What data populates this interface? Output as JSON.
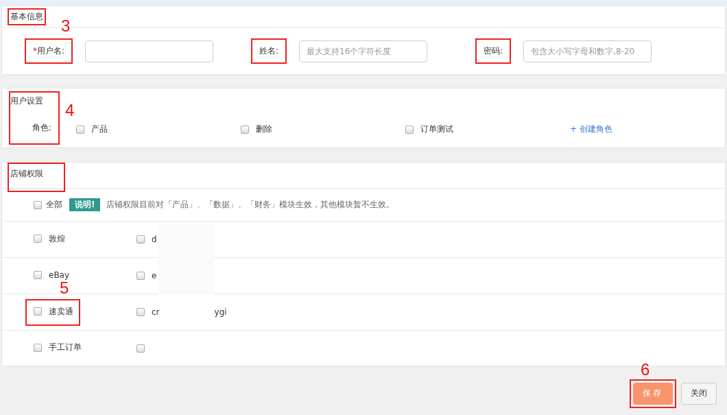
{
  "basic_info": {
    "title": "基本信息",
    "highlighted": true,
    "callout": "3",
    "fields": [
      {
        "label": "用户名:",
        "required_mark": "*",
        "highlighted": true
      },
      {
        "label": "姓名:",
        "highlighted": true,
        "placeholder": "最大支持16个字符长度"
      },
      {
        "label": "密码:",
        "highlighted": true,
        "placeholder": "包含大小写字母和数字,8-20"
      }
    ]
  },
  "user_settings": {
    "title": "用户设置",
    "highlighted": true,
    "callout": "4",
    "roles_label": "角色:",
    "roles": [
      {
        "label": "产品",
        "checked": false
      },
      {
        "label": "删除",
        "checked": false
      },
      {
        "label": "订单测试",
        "checked": false
      }
    ],
    "create_link": "+ 创建角色"
  },
  "store_permissions": {
    "title": "店铺权限",
    "highlighted": true,
    "all": {
      "label": "全部",
      "checked": false
    },
    "badge": "说明!",
    "note": "店铺权限目前对「产品」、「数据」、「财务」模块生效，其他模块暂不生效。",
    "rows": [
      {
        "platform": {
          "label": "敦煌",
          "checked": false,
          "highlighted": false
        },
        "store": {
          "label": "d",
          "checked": false
        }
      },
      {
        "platform": {
          "label": "eBay",
          "checked": false,
          "highlighted": false
        },
        "store": {
          "label": "e",
          "checked": false
        }
      },
      {
        "platform": {
          "label": "速卖通",
          "checked": false,
          "highlighted": true,
          "callout": "5"
        },
        "store": {
          "label": "cr",
          "tail": "ygi",
          "checked": false
        }
      },
      {
        "platform": {
          "label": "手工订单",
          "checked": false,
          "highlighted": false
        },
        "store": {
          "checked": false
        }
      }
    ]
  },
  "buttons": [
    {
      "label": "保存",
      "kind": "primary",
      "highlighted": true,
      "callout": "6"
    },
    {
      "label": "关闭",
      "kind": "default",
      "highlighted": false
    }
  ]
}
